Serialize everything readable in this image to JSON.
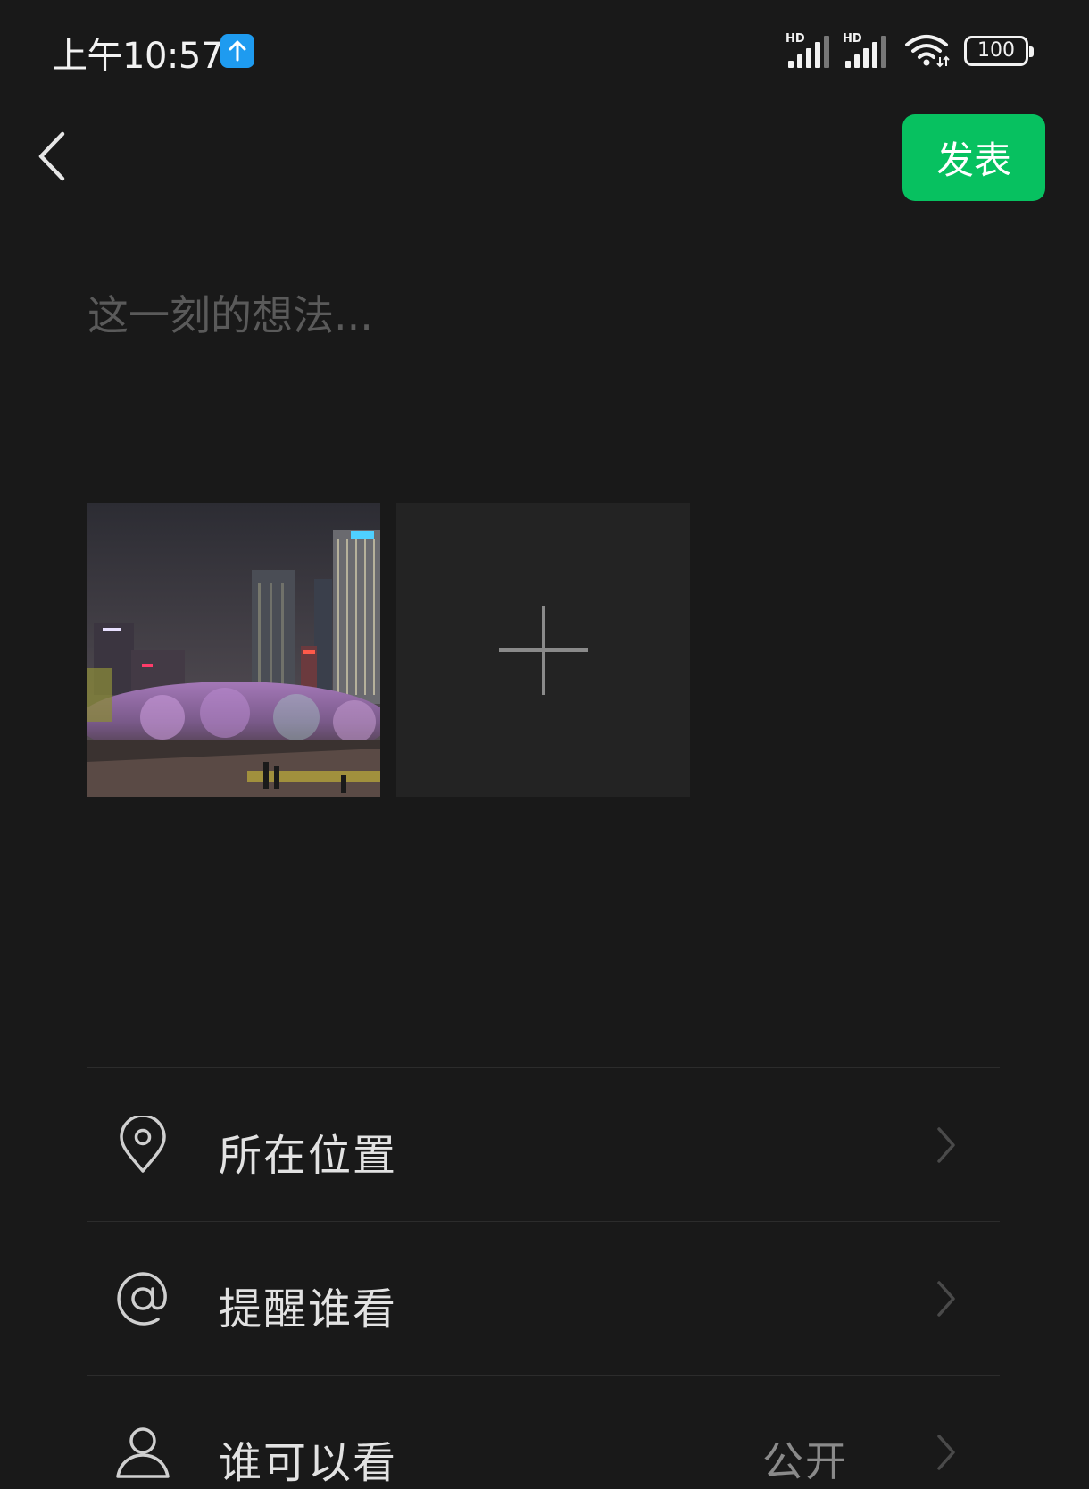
{
  "status_bar": {
    "time": "上午10:57",
    "signal_1_label": "HD",
    "signal_2_label": "HD",
    "battery": "100"
  },
  "header": {
    "publish_label": "发表"
  },
  "composer": {
    "placeholder": "这一刻的想法..."
  },
  "options": [
    {
      "label": "所在位置",
      "icon": "location-pin-icon",
      "value": ""
    },
    {
      "label": "提醒谁看",
      "icon": "at-sign-icon",
      "value": ""
    },
    {
      "label": "谁可以看",
      "icon": "person-icon",
      "value": "公开"
    }
  ],
  "colors": {
    "background": "#191919",
    "accent": "#07c160",
    "add_tile": "#232323",
    "divider": "#2c2c2c",
    "upload_badge": "#1e9bf0"
  }
}
